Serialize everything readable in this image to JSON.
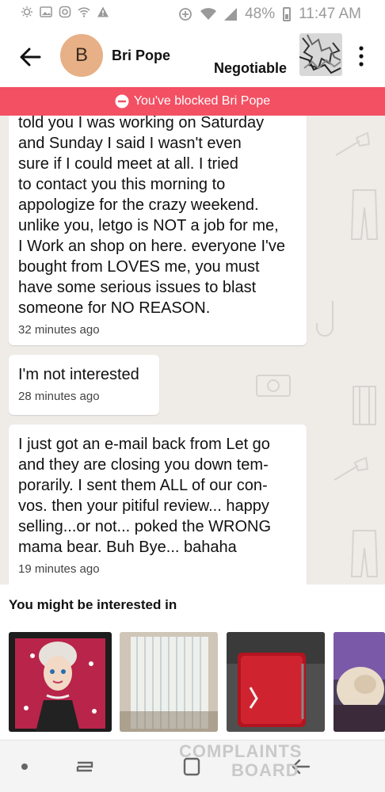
{
  "status_bar": {
    "battery": "48%",
    "time": "11:47 AM"
  },
  "header": {
    "avatar_letter": "B",
    "name": "Bri Pope",
    "price": "Negotiable"
  },
  "banner": {
    "text": "You've blocked Bri Pope"
  },
  "messages": [
    {
      "lines": [
        "told you I was working on Saturday",
        "and Sunday I said I wasn't even",
        "sure if I could meet at all. I tried",
        "to contact you this morning to",
        "appologize for the crazy weekend.",
        "unlike you, letgo is NOT a job for me,",
        "I Work an shop on here. everyone I've",
        "bought from LOVES me, you must",
        "have some serious issues to blast",
        "someone for NO REASON."
      ],
      "time": "32 minutes ago"
    },
    {
      "lines": [
        "I'm not interested"
      ],
      "time": "28 minutes ago"
    },
    {
      "lines": [
        "I just got an e-mail back from Let go",
        "and they are closing you down tem-",
        "porarily. I sent them ALL of our con-",
        "vos. then your pitiful review... happy",
        "selling...or not... poked the WRONG",
        "mama bear. Buh Bye... bahaha"
      ],
      "time": "19 minutes ago"
    }
  ],
  "suggestions": {
    "title": "You might be interested in"
  },
  "watermark": {
    "line1": "COMPLAINTS",
    "line2": "BOARD"
  }
}
